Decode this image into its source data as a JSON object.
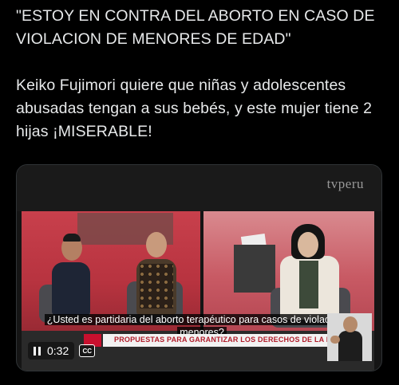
{
  "post": {
    "text": "\"ESTOY EN CONTRA DEL ABORTO EN CASO DE VIOLACION DE MENORES DE EDAD\"\n\nKeiko Fujimori quiere que niñas y adolescentes abusadas tengan a sus bebés, y este mujer tiene 2 hijas ¡MISERABLE!"
  },
  "video": {
    "watermark": "tvperu",
    "subtitle": "¿Usted es partidaria del aborto terapéutico para casos de violación en menores?",
    "lower_third": "PROPUESTAS PARA GARANTIZAR LOS DERECHOS DE LA INFANCIA",
    "time": "0:32",
    "cc_label": "CC",
    "accent": "#c8102e"
  }
}
